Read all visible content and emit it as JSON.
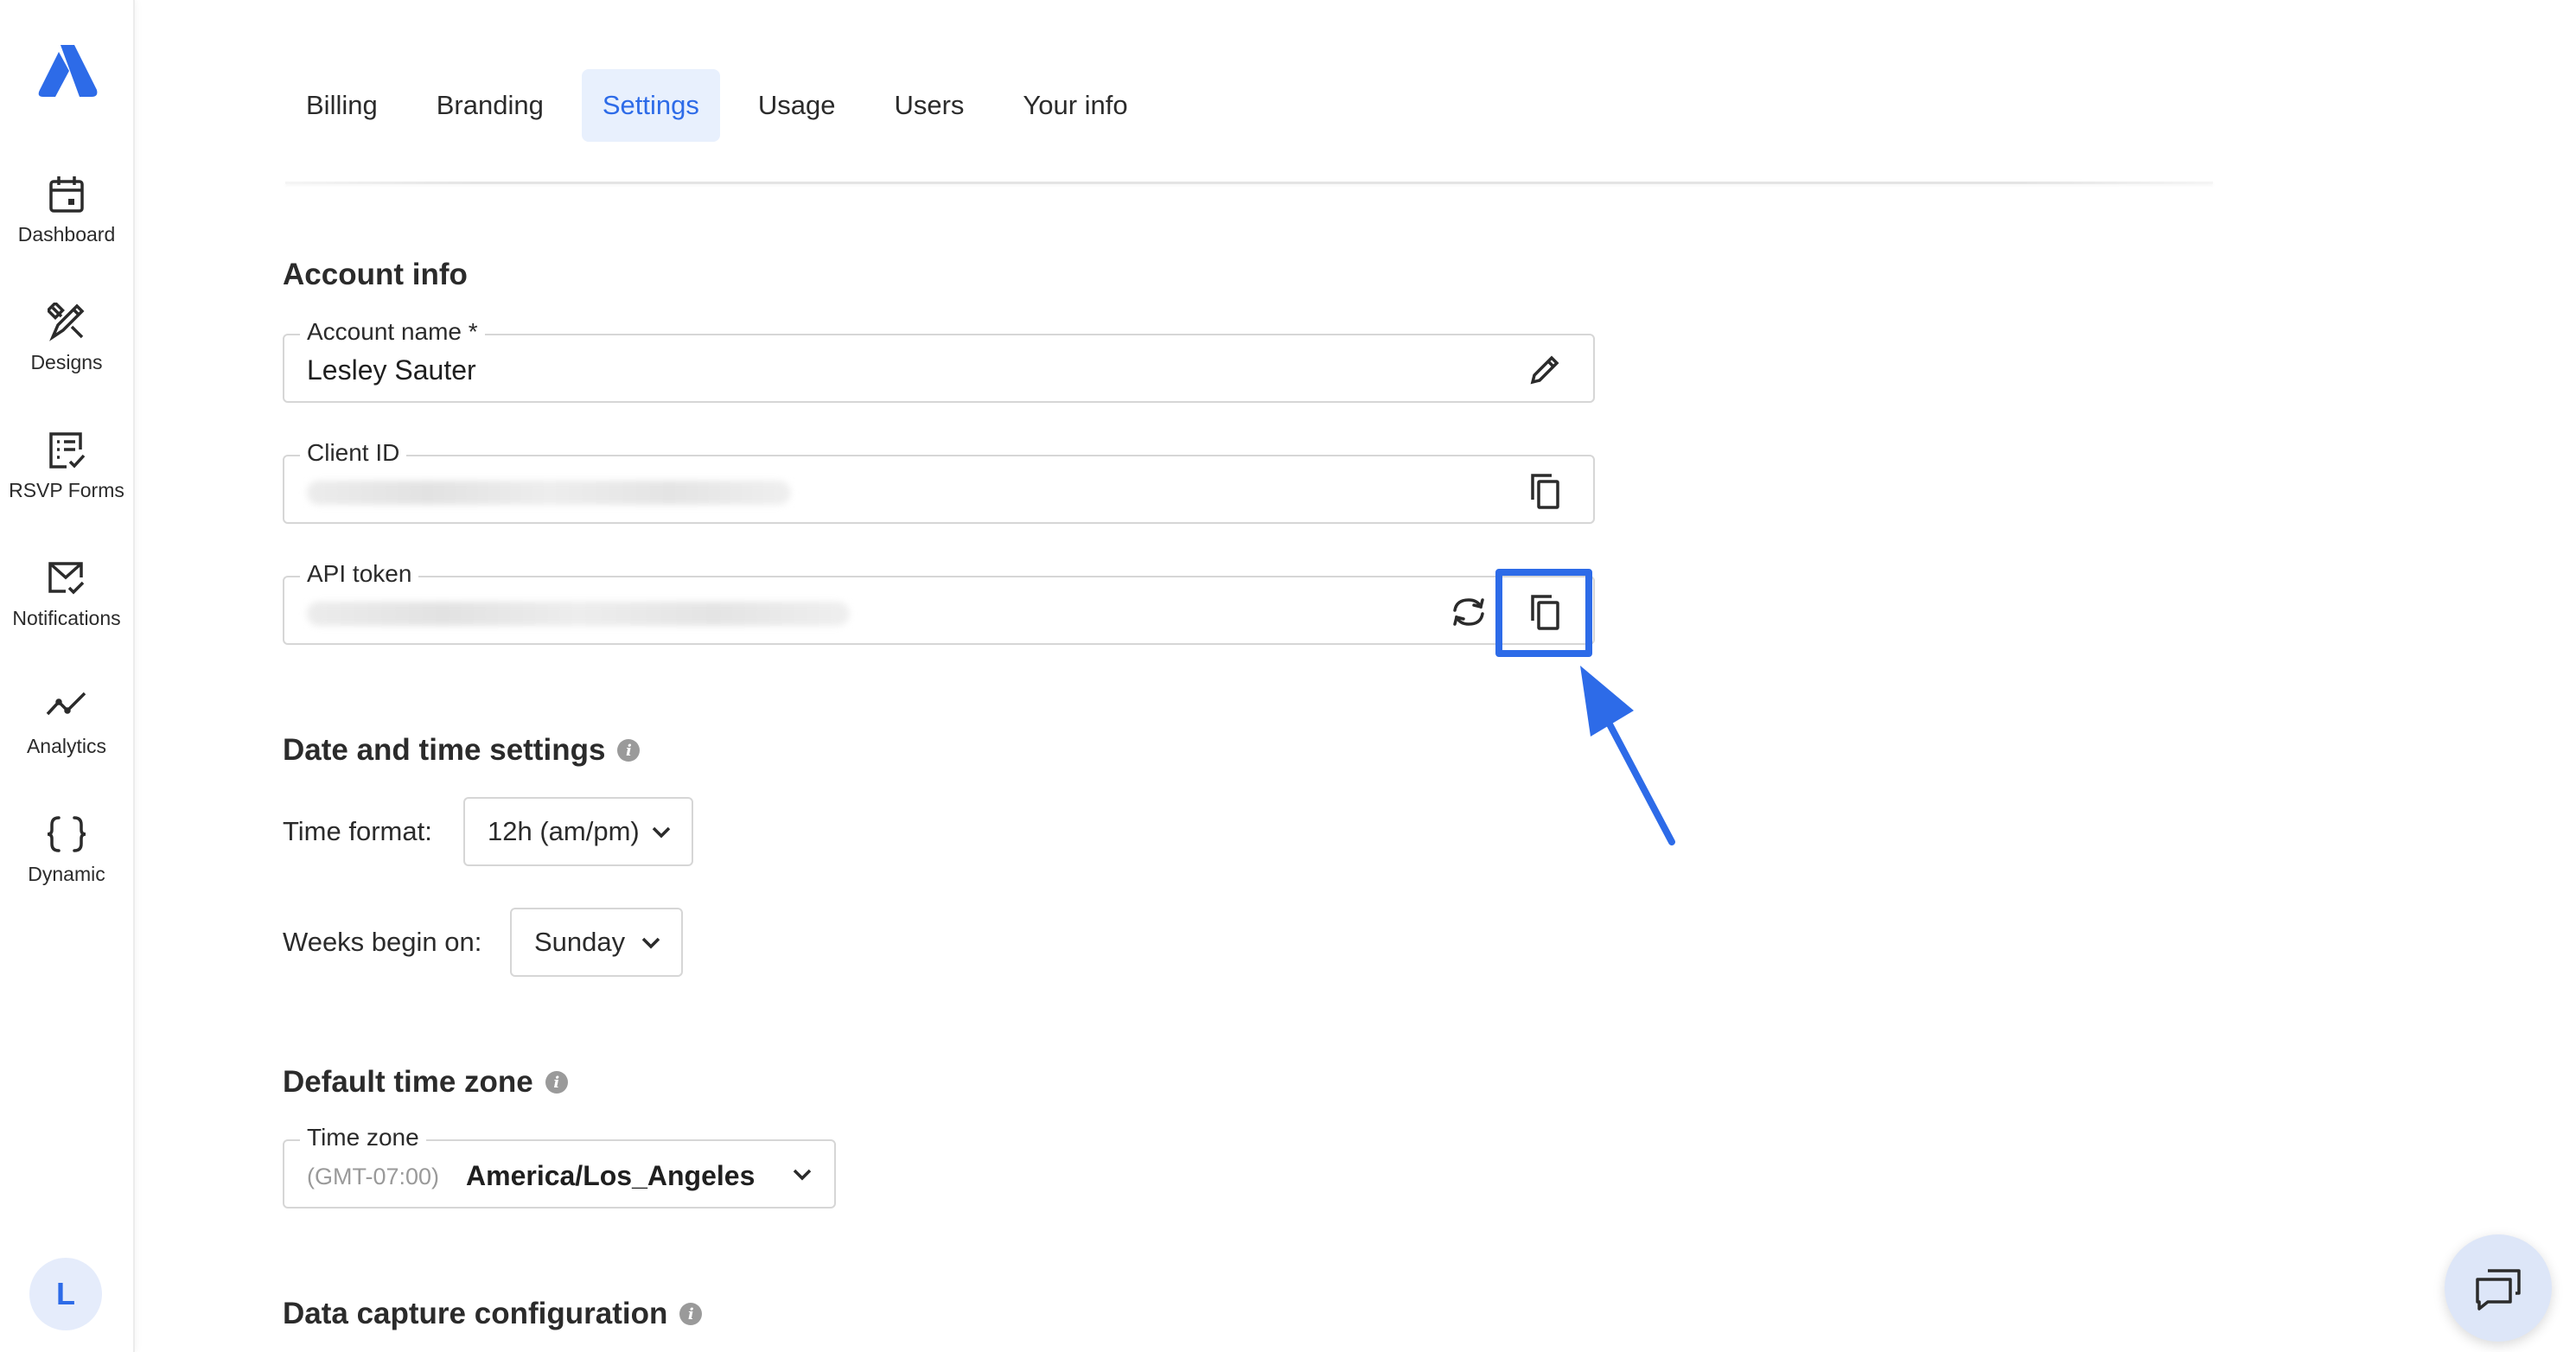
{
  "sidebar": {
    "items": [
      {
        "label": "Dashboard",
        "icon": "calendar-icon"
      },
      {
        "label": "Designs",
        "icon": "design-tools-icon"
      },
      {
        "label": "RSVP Forms",
        "icon": "form-check-icon"
      },
      {
        "label": "Notifications",
        "icon": "mail-check-icon"
      },
      {
        "label": "Analytics",
        "icon": "trend-line-icon"
      },
      {
        "label": "Dynamic",
        "icon": "curly-braces-icon"
      }
    ],
    "avatar_initial": "L"
  },
  "tabs": [
    {
      "label": "Billing",
      "active": false
    },
    {
      "label": "Branding",
      "active": false
    },
    {
      "label": "Settings",
      "active": true
    },
    {
      "label": "Usage",
      "active": false
    },
    {
      "label": "Users",
      "active": false
    },
    {
      "label": "Your info",
      "active": false
    }
  ],
  "account_info": {
    "title": "Account info",
    "account_name": {
      "label": "Account name *",
      "value": "Lesley Sauter"
    },
    "client_id": {
      "label": "Client ID"
    },
    "api_token": {
      "label": "API token"
    }
  },
  "date_time": {
    "title": "Date and time settings",
    "time_format_label": "Time format:",
    "time_format_value": "12h (am/pm)",
    "weeks_begin_label": "Weeks begin on:",
    "weeks_begin_value": "Sunday"
  },
  "timezone": {
    "title": "Default time zone",
    "label": "Time zone",
    "offset": "(GMT-07:00)",
    "value": "America/Los_Angeles"
  },
  "data_capture": {
    "title": "Data capture configuration"
  },
  "colors": {
    "accent": "#2d6be8",
    "active_tab_bg": "#e8f0fd",
    "border": "#d6d6d6"
  }
}
